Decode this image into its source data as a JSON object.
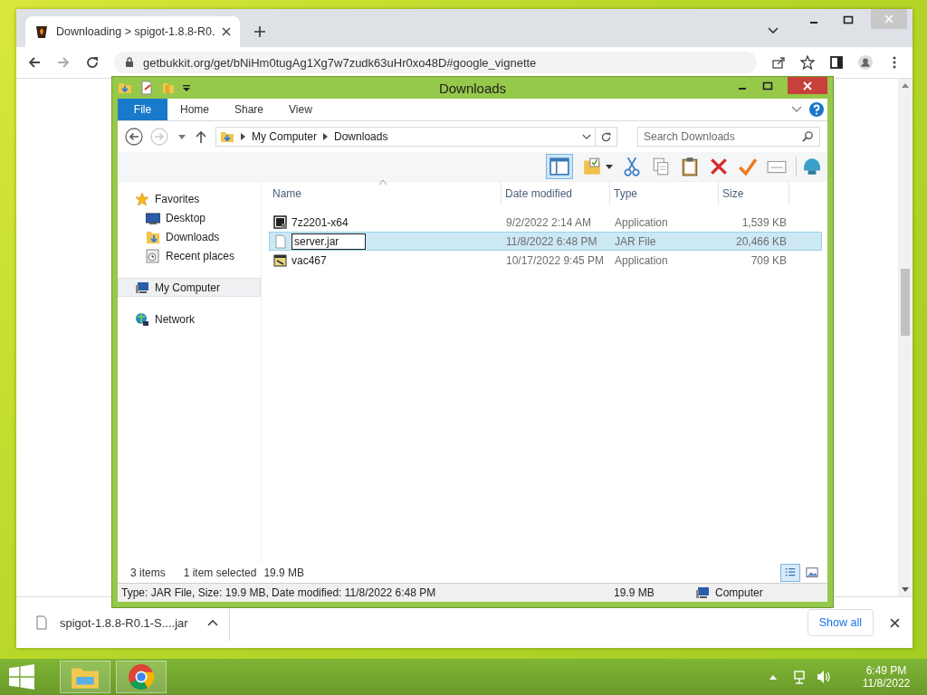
{
  "browser": {
    "tab": {
      "title": "Downloading > spigot-1.8.8-R0."
    },
    "url": "getbukkit.org/get/bNiHm0tugAg1Xg7w7zudk63uHr0xo48D#google_vignette",
    "download_bar": {
      "file": "spigot-1.8.8-R0.1-S....jar",
      "show_all": "Show all"
    }
  },
  "explorer": {
    "title": "Downloads",
    "ribbon_tabs": [
      {
        "label": "File",
        "kind": "file",
        "selected": false
      },
      {
        "label": "Home",
        "kind": "tab",
        "selected": false
      },
      {
        "label": "Share",
        "kind": "tab",
        "selected": false
      },
      {
        "label": "View",
        "kind": "tab",
        "selected": false
      }
    ],
    "breadcrumb": [
      "My Computer",
      "Downloads"
    ],
    "search": {
      "placeholder": "Search Downloads"
    },
    "nav": [
      {
        "label": "Favorites",
        "kind": "star",
        "selected": false,
        "children": [
          {
            "label": "Desktop",
            "kind": "desktop",
            "selected": false
          },
          {
            "label": "Downloads",
            "kind": "folder",
            "selected": false
          },
          {
            "label": "Recent places",
            "kind": "recent",
            "selected": false
          }
        ]
      },
      {
        "label": "My Computer",
        "kind": "computer",
        "selected": true
      },
      {
        "label": "Network",
        "kind": "network",
        "selected": false
      }
    ],
    "columns": [
      "Name",
      "Date modified",
      "Type",
      "Size"
    ],
    "rows": [
      {
        "name": "7z2201-x64",
        "kind": "archive",
        "date": "9/2/2022 2:14 AM",
        "type": "Application",
        "size": "1,539 KB",
        "selected": false,
        "renaming": false
      },
      {
        "name": "server.jar",
        "kind": "blank",
        "date": "11/8/2022 6:48 PM",
        "type": "JAR File",
        "size": "20,466 KB",
        "selected": true,
        "renaming": true
      },
      {
        "name": "vac467",
        "kind": "app",
        "date": "10/17/2022 9:45 PM",
        "type": "Application",
        "size": "709 KB",
        "selected": false,
        "renaming": false
      }
    ],
    "status": {
      "items": "3 items",
      "selection": "1 item selected",
      "size": "19.9 MB"
    },
    "details_bar": {
      "text": "Type: JAR File, Size: 19.9 MB, Date modified: 11/8/2022 6:48 PM",
      "size": "19.9 MB",
      "location": "Computer"
    }
  },
  "taskbar": {
    "time": "6:49 PM",
    "date": "11/8/2022"
  }
}
